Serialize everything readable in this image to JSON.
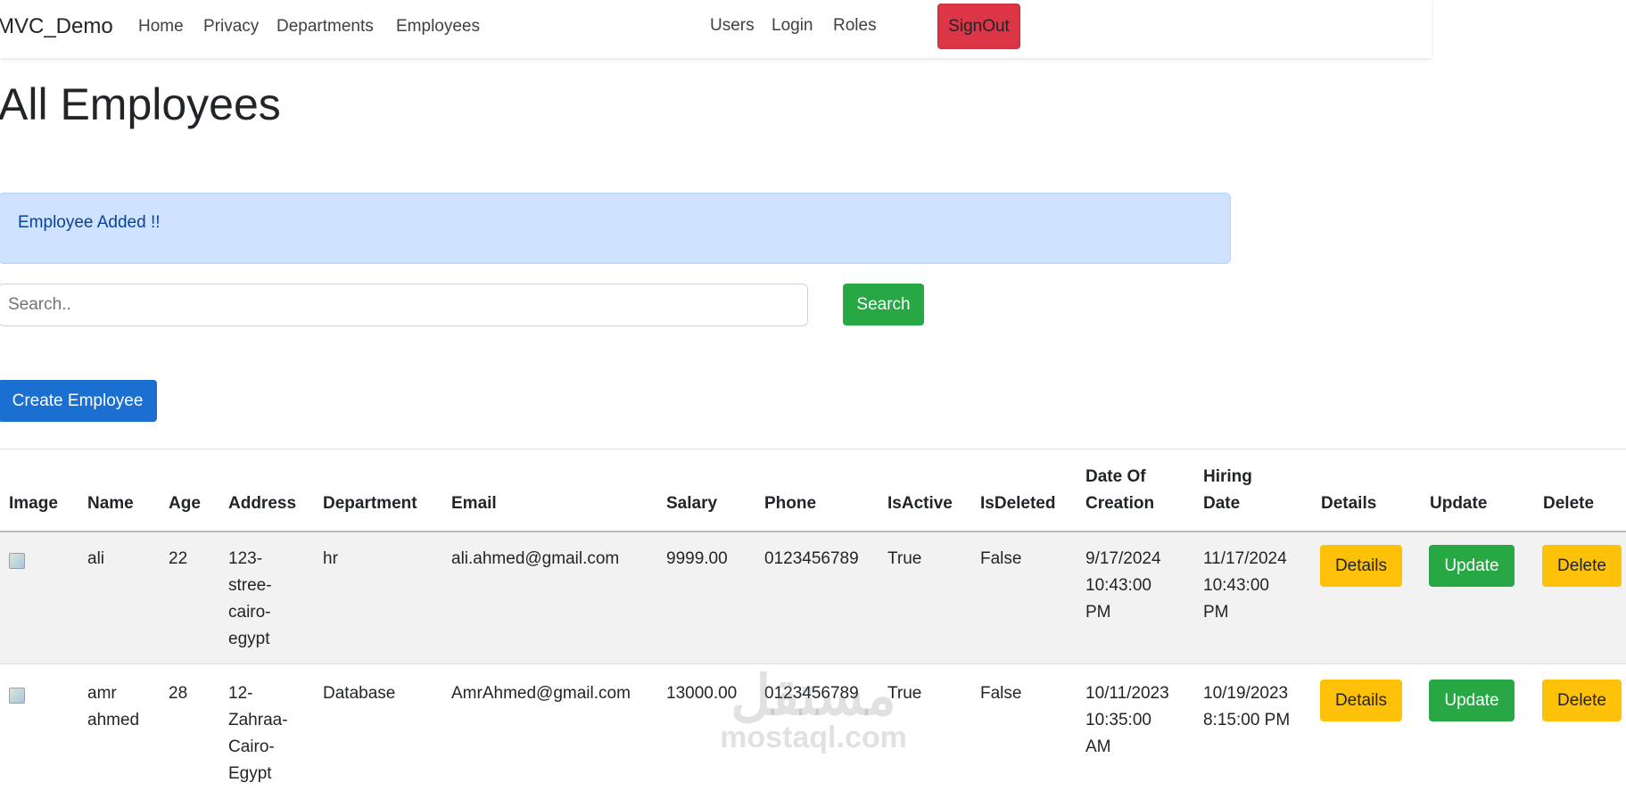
{
  "navbar": {
    "brand": "MVC_Demo",
    "links": [
      "Home",
      "Privacy",
      "Departments",
      "Employees"
    ],
    "right_links": [
      "Users",
      "Login",
      "Roles"
    ],
    "signout_label": "SignOut"
  },
  "page": {
    "title": "All Employees",
    "alert": "Employee Added !!",
    "search_placeholder": "Search..",
    "search_button": "Search",
    "create_button": "Create Employee"
  },
  "table": {
    "headers": {
      "image": "Image",
      "name": "Name",
      "age": "Age",
      "address": "Address",
      "department": "Department",
      "email": "Email",
      "salary": "Salary",
      "phone": "Phone",
      "isactive": "IsActive",
      "isdeleted": "IsDeleted",
      "date_creation_1": "Date Of",
      "date_creation_2": "Creation",
      "hiring_1": "Hiring",
      "hiring_2": "Date",
      "details": "Details",
      "update": "Update",
      "delete": "Delete"
    },
    "rows": [
      {
        "name": [
          "ali"
        ],
        "age": "22",
        "address": [
          "123-",
          "stree-",
          "cairo-",
          "egypt"
        ],
        "department": "hr",
        "email": "ali.ahmed@gmail.com",
        "salary": "9999.00",
        "phone": "0123456789",
        "isactive": "True",
        "isdeleted": "False",
        "created": [
          "9/17/2024",
          "10:43:00",
          "PM"
        ],
        "hired": [
          "11/17/2024",
          "10:43:00",
          "PM"
        ],
        "details_label": "Details",
        "update_label": "Update",
        "delete_label": "Delete"
      },
      {
        "name": [
          "amr",
          "ahmed"
        ],
        "age": "28",
        "address": [
          "12-",
          "Zahraa-",
          "Cairo-",
          "Egypt"
        ],
        "department": "Database",
        "email": "AmrAhmed@gmail.com",
        "salary": "13000.00",
        "phone": "0123456789",
        "isactive": "True",
        "isdeleted": "False",
        "created": [
          "10/11/2023",
          "10:35:00",
          "AM"
        ],
        "hired": [
          "10/19/2023",
          "8:15:00 PM"
        ],
        "details_label": "Details",
        "update_label": "Update",
        "delete_label": "Delete"
      }
    ]
  },
  "watermark": {
    "mark": "مستقل",
    "text": "mostaql.com"
  }
}
